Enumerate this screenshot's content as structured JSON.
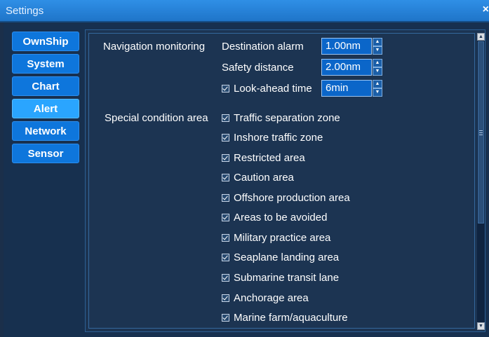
{
  "window": {
    "title": "Settings",
    "close_glyph": "×"
  },
  "nav": {
    "items": [
      "OwnShip",
      "System",
      "Chart",
      "Alert",
      "Network",
      "Sensor"
    ],
    "active": "Alert"
  },
  "navigation_monitoring": {
    "label": "Navigation monitoring",
    "destination_alarm": {
      "label": "Destination alarm",
      "value": "1.00nm"
    },
    "safety_distance": {
      "label": "Safety distance",
      "value": "2.00nm"
    },
    "look_ahead_time": {
      "label": "Look-ahead time",
      "value": "6min",
      "checked": true
    }
  },
  "special_condition_area": {
    "label": "Special condition area",
    "items": [
      {
        "label": "Traffic separation zone",
        "checked": true
      },
      {
        "label": "Inshore traffic zone",
        "checked": true
      },
      {
        "label": "Restricted area",
        "checked": true
      },
      {
        "label": "Caution area",
        "checked": true
      },
      {
        "label": "Offshore production area",
        "checked": true
      },
      {
        "label": "Areas to be avoided",
        "checked": true
      },
      {
        "label": "Military practice area",
        "checked": true
      },
      {
        "label": "Seaplane landing area",
        "checked": true
      },
      {
        "label": "Submarine transit lane",
        "checked": true
      },
      {
        "label": "Anchorage area",
        "checked": true
      },
      {
        "label": "Marine farm/aquaculture",
        "checked": true
      }
    ]
  },
  "colors": {
    "nav_button": "#0e76dc",
    "nav_button_active": "#2aa5ff",
    "background": "#1b2f4a",
    "spin_input": "#0b66c9"
  }
}
